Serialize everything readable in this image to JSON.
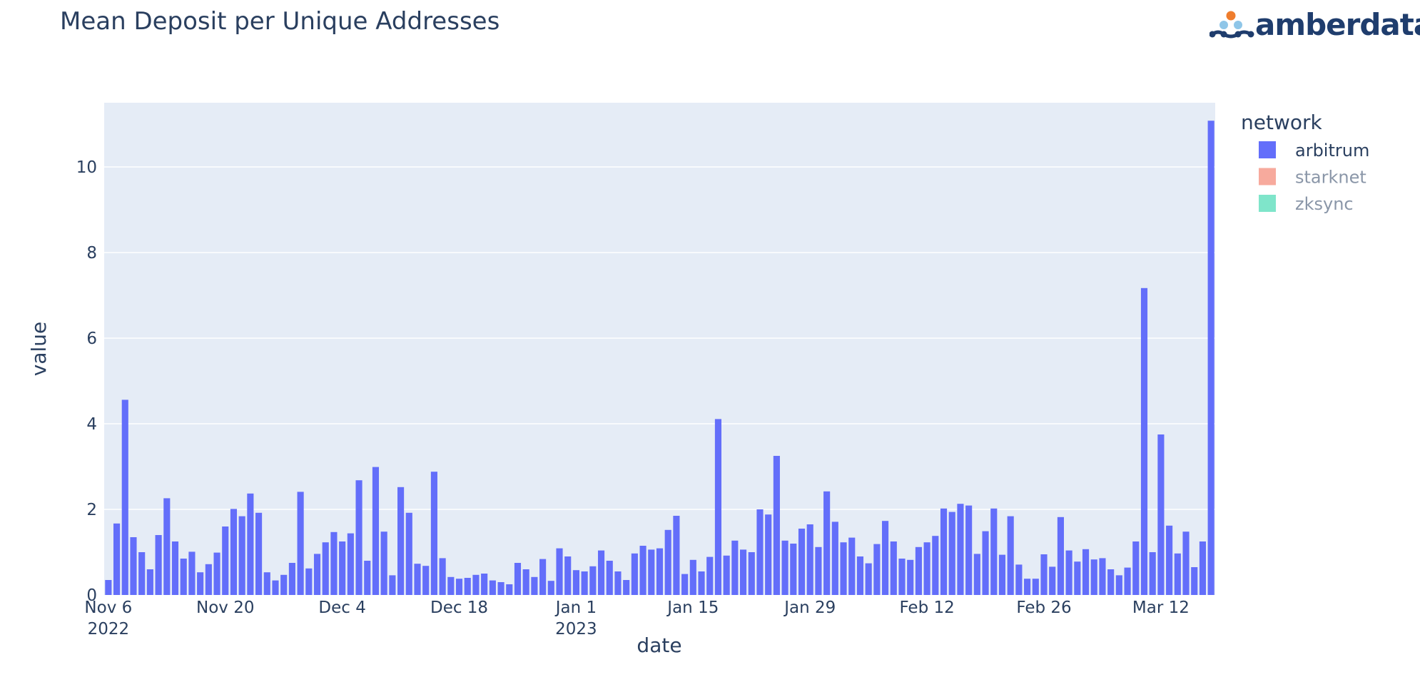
{
  "chart_data": {
    "type": "bar",
    "title": "Mean Deposit per Unique Addresses",
    "xlabel": "date",
    "ylabel": "value",
    "ylim": [
      0,
      11.5
    ],
    "yticks": [
      0,
      2,
      4,
      6,
      8,
      10
    ],
    "x_start": "2022-11-06",
    "xticks": [
      {
        "label": "Nov 6",
        "sub": "2022",
        "date": "2022-11-06"
      },
      {
        "label": "Nov 20",
        "sub": "",
        "date": "2022-11-20"
      },
      {
        "label": "Dec 4",
        "sub": "",
        "date": "2022-12-04"
      },
      {
        "label": "Dec 18",
        "sub": "",
        "date": "2022-12-18"
      },
      {
        "label": "Jan 1",
        "sub": "2023",
        "date": "2023-01-01"
      },
      {
        "label": "Jan 15",
        "sub": "",
        "date": "2023-01-15"
      },
      {
        "label": "Jan 29",
        "sub": "",
        "date": "2023-01-29"
      },
      {
        "label": "Feb 12",
        "sub": "",
        "date": "2023-02-12"
      },
      {
        "label": "Feb 26",
        "sub": "",
        "date": "2023-02-26"
      },
      {
        "label": "Mar 12",
        "sub": "",
        "date": "2023-03-12"
      }
    ],
    "grid": true,
    "legend_title": "network",
    "legend_position": "top-right",
    "series": [
      {
        "name": "arbitrum",
        "color": "#636efa",
        "active": true,
        "values": [
          0.35,
          1.67,
          4.56,
          1.35,
          1.0,
          0.6,
          1.4,
          2.26,
          1.25,
          0.85,
          1.01,
          0.53,
          0.72,
          0.99,
          1.6,
          2.01,
          1.84,
          2.37,
          1.92,
          0.53,
          0.34,
          0.47,
          0.75,
          2.41,
          0.62,
          0.96,
          1.23,
          1.47,
          1.25,
          1.44,
          2.68,
          0.8,
          2.99,
          1.48,
          0.46,
          2.52,
          1.92,
          0.73,
          0.68,
          2.88,
          0.86,
          0.42,
          0.38,
          0.4,
          0.47,
          0.5,
          0.34,
          0.3,
          0.25,
          0.75,
          0.6,
          0.42,
          0.84,
          0.33,
          1.09,
          0.9,
          0.58,
          0.55,
          0.67,
          1.04,
          0.8,
          0.55,
          0.35,
          0.97,
          1.15,
          1.06,
          1.09,
          1.52,
          1.85,
          0.49,
          0.82,
          0.55,
          0.89,
          4.11,
          0.92,
          1.27,
          1.06,
          1.0,
          2.0,
          1.88,
          3.25,
          1.27,
          1.2,
          1.55,
          1.65,
          1.12,
          2.42,
          1.71,
          1.23,
          1.34,
          0.9,
          0.74,
          1.19,
          1.73,
          1.25,
          0.85,
          0.82,
          1.12,
          1.23,
          1.38,
          2.02,
          1.94,
          2.13,
          2.09,
          0.96,
          1.49,
          2.02,
          0.94,
          1.84,
          0.71,
          0.38,
          0.38,
          0.95,
          0.66,
          1.82,
          1.04,
          0.78,
          1.07,
          0.83,
          0.86,
          0.6,
          0.46,
          0.64,
          1.25,
          7.17,
          1.0,
          3.75,
          1.62,
          0.97,
          1.48,
          0.65,
          1.25,
          11.08
        ]
      },
      {
        "name": "starknet",
        "color": "#ef553b",
        "active": false,
        "values": []
      },
      {
        "name": "zksync",
        "color": "#00cc96",
        "active": false,
        "values": []
      }
    ]
  },
  "logo": {
    "text": "amberdata",
    "colors": {
      "dot_orange": "#ef7d2d",
      "dot_light": "#8fc6e8",
      "dot_navy": "#1f3d6d"
    }
  },
  "theme": {
    "plot_bg": "#e5ecf6",
    "grid": "#ffffff",
    "text": "#2a3f5f",
    "legend_inactive_text": "#8a96a8"
  }
}
